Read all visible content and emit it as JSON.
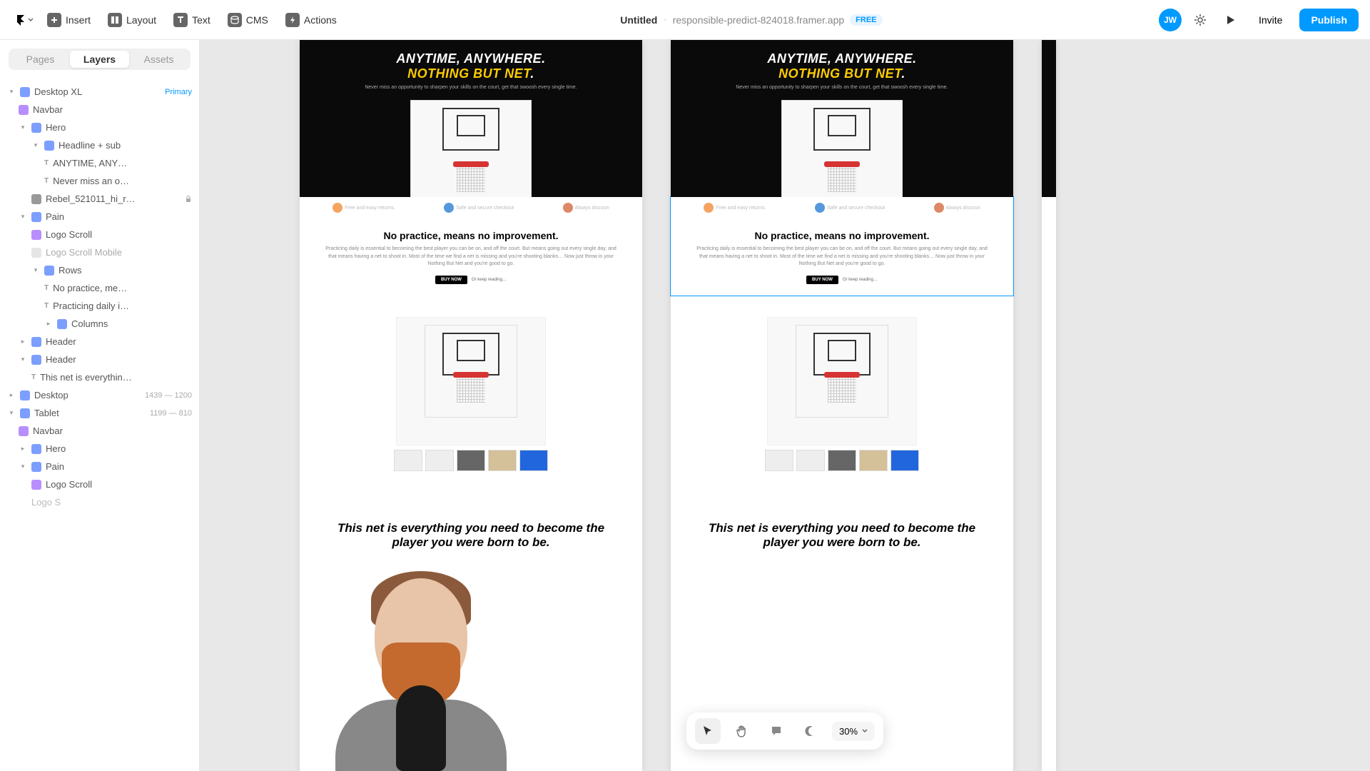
{
  "toolbar": {
    "insert": "Insert",
    "layout": "Layout",
    "text": "Text",
    "cms": "CMS",
    "actions": "Actions",
    "title": "Untitled",
    "domain": "responsible-predict-824018.framer.app",
    "free": "FREE",
    "avatar": "JW",
    "invite": "Invite",
    "publish": "Publish"
  },
  "panel": {
    "tabs": {
      "pages": "Pages",
      "layers": "Layers",
      "assets": "Assets"
    }
  },
  "tree": {
    "desktop_xl": "Desktop XL",
    "primary": "Primary",
    "navbar": "Navbar",
    "hero": "Hero",
    "headline_sub": "Headline + sub",
    "anytime": "ANYTIME, ANY…",
    "never_miss": "Never miss an o…",
    "rebel_img": "Rebel_521011_hi_r…",
    "pain": "Pain",
    "logo_scroll": "Logo Scroll",
    "logo_scroll_mobile": "Logo Scroll Mobile",
    "rows": "Rows",
    "no_practice": "No practice, me…",
    "practicing": "Practicing daily i…",
    "columns": "Columns",
    "header": "Header",
    "header2": "Header",
    "this_net": "This net is everythin…",
    "desktop": "Desktop",
    "desktop_dim": "1439 — 1200",
    "tablet": "Tablet",
    "tablet_dim": "1199 — 810",
    "navbar2": "Navbar",
    "hero2": "Hero",
    "pain2": "Pain",
    "logo_scroll2": "Logo Scroll",
    "logo_s": "Logo S"
  },
  "site": {
    "hero_line1": "ANYTIME, ANYWHERE.",
    "hero_line2": "NOTHING BUT NET",
    "hero_dot": ".",
    "hero_sub": "Never miss an opportunity to sharpen your skills on the court, get that swoosh every single time.",
    "strip1": "Free and easy returns.",
    "strip2": "Safe and secure checkout",
    "strip3": "Always discoun",
    "pain_h2": "No practice, means no improvement.",
    "pain_p": "Practicing daily is essential to becoming the best player you can be on, and off the court. But means going out every single day, and that means having a net to shoot in. Most of the time we find a net is missing and you're shooting blanks… Now just throw in your Nothing But Net and you're good to go.",
    "buy_now": "BUY NOW",
    "keep_reading": "Or keep reading…",
    "header2_text": "This net is everything you need to become the player you were born to be."
  },
  "bottom": {
    "zoom": "30%"
  }
}
